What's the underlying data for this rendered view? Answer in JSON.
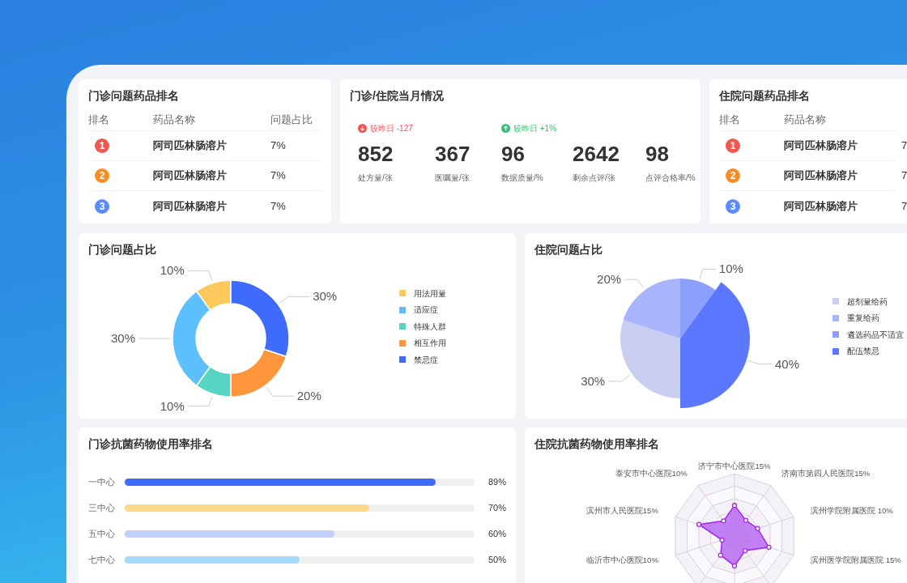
{
  "outpatient_ranking": {
    "title": "门诊问题药品排名",
    "columns": [
      "排名",
      "药品名称",
      "问题占比"
    ],
    "rows": [
      {
        "rank": "1",
        "color": "#f0584f",
        "drug": "阿司匹林肠溶片",
        "share": "7%"
      },
      {
        "rank": "2",
        "color": "#fb8c24",
        "drug": "阿司匹林肠溶片",
        "share": "7%"
      },
      {
        "rank": "3",
        "color": "#5b8cff",
        "drug": "阿司匹林肠溶片",
        "share": "7%"
      }
    ]
  },
  "monthly_overview": {
    "title": "门诊/住院当月情况",
    "stats": [
      {
        "value": "852",
        "label": "处方量/张",
        "change": {
          "text": "较昨日 -127",
          "increase": false
        }
      },
      {
        "value": "367",
        "label": "医嘱量/张"
      },
      {
        "value": "96",
        "label": "数据质量/%",
        "change": {
          "text": "较昨日 +1%",
          "increase": true
        }
      },
      {
        "value": "2642",
        "label": "剩余点评/张"
      },
      {
        "value": "98",
        "label": "点评合格率/%"
      }
    ]
  },
  "inpatient_ranking": {
    "title": "住院问题药品排名",
    "columns": [
      "排名",
      "药品名称"
    ],
    "rows": [
      {
        "rank": "1",
        "color": "#f0584f",
        "drug": "阿司匹林肠溶片",
        "share": "7"
      },
      {
        "rank": "2",
        "color": "#fb8c24",
        "drug": "阿司匹林肠溶片",
        "share": "7"
      },
      {
        "rank": "3",
        "color": "#5b8cff",
        "drug": "阿司匹林肠溶片",
        "share": "7"
      }
    ]
  },
  "outpatient_share": {
    "title": "门诊问题占比",
    "chart_data": {
      "type": "donut",
      "categories": [
        "用法用量",
        "适应症",
        "特殊人群",
        "相互作用",
        "禁忌症"
      ],
      "values": [
        10,
        30,
        10,
        20,
        30
      ],
      "value_labels": [
        "10%",
        "30%",
        "10%",
        "20%",
        "30%"
      ]
    },
    "legend": [
      {
        "color": "#fdc95a"
      },
      {
        "color": "#5ebffd"
      },
      {
        "color": "#56d5c5"
      },
      {
        "color": "#fd953a"
      },
      {
        "color": "#3f6bfd"
      }
    ]
  },
  "inpatient_share": {
    "title": "住院问题占比",
    "chart_data": {
      "type": "pie",
      "categories": [
        "超剂量给药",
        "重复给药",
        "遴选药品不适宜",
        "配伍禁忌"
      ],
      "values": [
        30,
        20,
        10,
        40
      ],
      "value_labels": [
        "30%",
        "20%",
        "10%",
        "40%"
      ]
    },
    "legend": [
      {
        "color": "#c9cef0"
      },
      {
        "color": "#a8b5fd"
      },
      {
        "color": "#8c9ffd"
      },
      {
        "color": "#5b77fe"
      }
    ]
  },
  "outpatient_antibiotic": {
    "title": "门诊抗菌药物使用率排名",
    "rows": [
      {
        "label": "一中心",
        "level": 0.89,
        "reading": "89%",
        "color": "#3f6bfd"
      },
      {
        "label": "三中心",
        "level": 0.7,
        "reading": "70%",
        "color": "#fdda8b"
      },
      {
        "label": "五中心",
        "level": 0.6,
        "reading": "60%",
        "color": "#c2d0fd"
      },
      {
        "label": "七中心",
        "level": 0.5,
        "reading": "50%",
        "color": "#a4dbfd"
      }
    ]
  },
  "inpatient_antibiotic": {
    "title": "住院抗菌药物使用率排名",
    "radar_labels": [
      "济宁市中心医院15%",
      "泰安市中心医院10%",
      "济南市第四人民医院15%",
      "滨州市人民医院15%",
      "滨州学院附属医院 10%",
      "临沂市中心医院10%",
      "滨州医学院附属医院 15%"
    ]
  }
}
